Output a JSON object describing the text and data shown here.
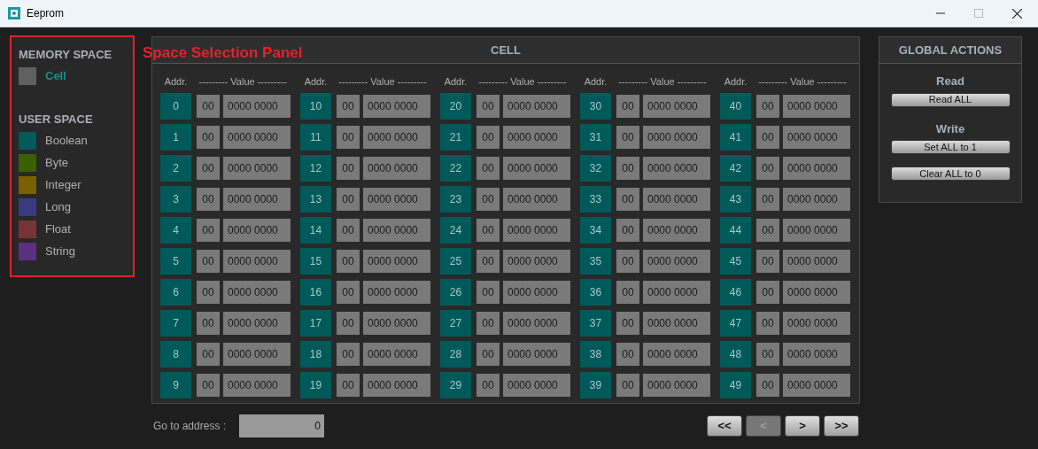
{
  "window": {
    "title": "Eeprom"
  },
  "annotation": {
    "label": "Space Selection Panel"
  },
  "memory_space": {
    "heading": "MEMORY SPACE",
    "items": [
      {
        "label": "Cell",
        "color": "#606060",
        "selected": true
      }
    ]
  },
  "user_space": {
    "heading": "USER SPACE",
    "items": [
      {
        "label": "Boolean",
        "color": "#005a5a",
        "selected": false
      },
      {
        "label": "Byte",
        "color": "#3a6000",
        "selected": false
      },
      {
        "label": "Integer",
        "color": "#7a6000",
        "selected": false
      },
      {
        "label": "Long",
        "color": "#3a3a80",
        "selected": false
      },
      {
        "label": "Float",
        "color": "#783434",
        "selected": false
      },
      {
        "label": "String",
        "color": "#5a3080",
        "selected": false
      }
    ]
  },
  "cell_panel": {
    "title": "CELL",
    "columns": [
      {
        "addr_header": "Addr.",
        "value_header": "--------- Value ---------",
        "cells": [
          {
            "addr": "0",
            "byte": "00",
            "bits": "0000 0000"
          },
          {
            "addr": "1",
            "byte": "00",
            "bits": "0000 0000"
          },
          {
            "addr": "2",
            "byte": "00",
            "bits": "0000 0000"
          },
          {
            "addr": "3",
            "byte": "00",
            "bits": "0000 0000"
          },
          {
            "addr": "4",
            "byte": "00",
            "bits": "0000 0000"
          },
          {
            "addr": "5",
            "byte": "00",
            "bits": "0000 0000"
          },
          {
            "addr": "6",
            "byte": "00",
            "bits": "0000 0000"
          },
          {
            "addr": "7",
            "byte": "00",
            "bits": "0000 0000"
          },
          {
            "addr": "8",
            "byte": "00",
            "bits": "0000 0000"
          },
          {
            "addr": "9",
            "byte": "00",
            "bits": "0000 0000"
          }
        ]
      },
      {
        "addr_header": "Addr.",
        "value_header": "--------- Value ---------",
        "cells": [
          {
            "addr": "10",
            "byte": "00",
            "bits": "0000 0000"
          },
          {
            "addr": "11",
            "byte": "00",
            "bits": "0000 0000"
          },
          {
            "addr": "12",
            "byte": "00",
            "bits": "0000 0000"
          },
          {
            "addr": "13",
            "byte": "00",
            "bits": "0000 0000"
          },
          {
            "addr": "14",
            "byte": "00",
            "bits": "0000 0000"
          },
          {
            "addr": "15",
            "byte": "00",
            "bits": "0000 0000"
          },
          {
            "addr": "16",
            "byte": "00",
            "bits": "0000 0000"
          },
          {
            "addr": "17",
            "byte": "00",
            "bits": "0000 0000"
          },
          {
            "addr": "18",
            "byte": "00",
            "bits": "0000 0000"
          },
          {
            "addr": "19",
            "byte": "00",
            "bits": "0000 0000"
          }
        ]
      },
      {
        "addr_header": "Addr.",
        "value_header": "--------- Value ---------",
        "cells": [
          {
            "addr": "20",
            "byte": "00",
            "bits": "0000 0000"
          },
          {
            "addr": "21",
            "byte": "00",
            "bits": "0000 0000"
          },
          {
            "addr": "22",
            "byte": "00",
            "bits": "0000 0000"
          },
          {
            "addr": "23",
            "byte": "00",
            "bits": "0000 0000"
          },
          {
            "addr": "24",
            "byte": "00",
            "bits": "0000 0000"
          },
          {
            "addr": "25",
            "byte": "00",
            "bits": "0000 0000"
          },
          {
            "addr": "26",
            "byte": "00",
            "bits": "0000 0000"
          },
          {
            "addr": "27",
            "byte": "00",
            "bits": "0000 0000"
          },
          {
            "addr": "28",
            "byte": "00",
            "bits": "0000 0000"
          },
          {
            "addr": "29",
            "byte": "00",
            "bits": "0000 0000"
          }
        ]
      },
      {
        "addr_header": "Addr.",
        "value_header": "--------- Value ---------",
        "cells": [
          {
            "addr": "30",
            "byte": "00",
            "bits": "0000 0000"
          },
          {
            "addr": "31",
            "byte": "00",
            "bits": "0000 0000"
          },
          {
            "addr": "32",
            "byte": "00",
            "bits": "0000 0000"
          },
          {
            "addr": "33",
            "byte": "00",
            "bits": "0000 0000"
          },
          {
            "addr": "34",
            "byte": "00",
            "bits": "0000 0000"
          },
          {
            "addr": "35",
            "byte": "00",
            "bits": "0000 0000"
          },
          {
            "addr": "36",
            "byte": "00",
            "bits": "0000 0000"
          },
          {
            "addr": "37",
            "byte": "00",
            "bits": "0000 0000"
          },
          {
            "addr": "38",
            "byte": "00",
            "bits": "0000 0000"
          },
          {
            "addr": "39",
            "byte": "00",
            "bits": "0000 0000"
          }
        ]
      },
      {
        "addr_header": "Addr.",
        "value_header": "--------- Value ---------",
        "cells": [
          {
            "addr": "40",
            "byte": "00",
            "bits": "0000 0000"
          },
          {
            "addr": "41",
            "byte": "00",
            "bits": "0000 0000"
          },
          {
            "addr": "42",
            "byte": "00",
            "bits": "0000 0000"
          },
          {
            "addr": "43",
            "byte": "00",
            "bits": "0000 0000"
          },
          {
            "addr": "44",
            "byte": "00",
            "bits": "0000 0000"
          },
          {
            "addr": "45",
            "byte": "00",
            "bits": "0000 0000"
          },
          {
            "addr": "46",
            "byte": "00",
            "bits": "0000 0000"
          },
          {
            "addr": "47",
            "byte": "00",
            "bits": "0000 0000"
          },
          {
            "addr": "48",
            "byte": "00",
            "bits": "0000 0000"
          },
          {
            "addr": "49",
            "byte": "00",
            "bits": "0000 0000"
          }
        ]
      }
    ]
  },
  "goto": {
    "label": "Go to address :",
    "value": "0"
  },
  "nav_buttons": [
    {
      "label": "<<",
      "disabled": false
    },
    {
      "label": "<",
      "disabled": true
    },
    {
      "label": ">",
      "disabled": false
    },
    {
      "label": ">>",
      "disabled": false
    }
  ],
  "global_actions": {
    "title": "GLOBAL ACTIONS",
    "groups": [
      {
        "heading": "Read",
        "buttons": [
          "Read ALL"
        ]
      },
      {
        "heading": "Write",
        "buttons": [
          "Set ALL to 1",
          "Clear ALL to 0"
        ]
      }
    ]
  }
}
